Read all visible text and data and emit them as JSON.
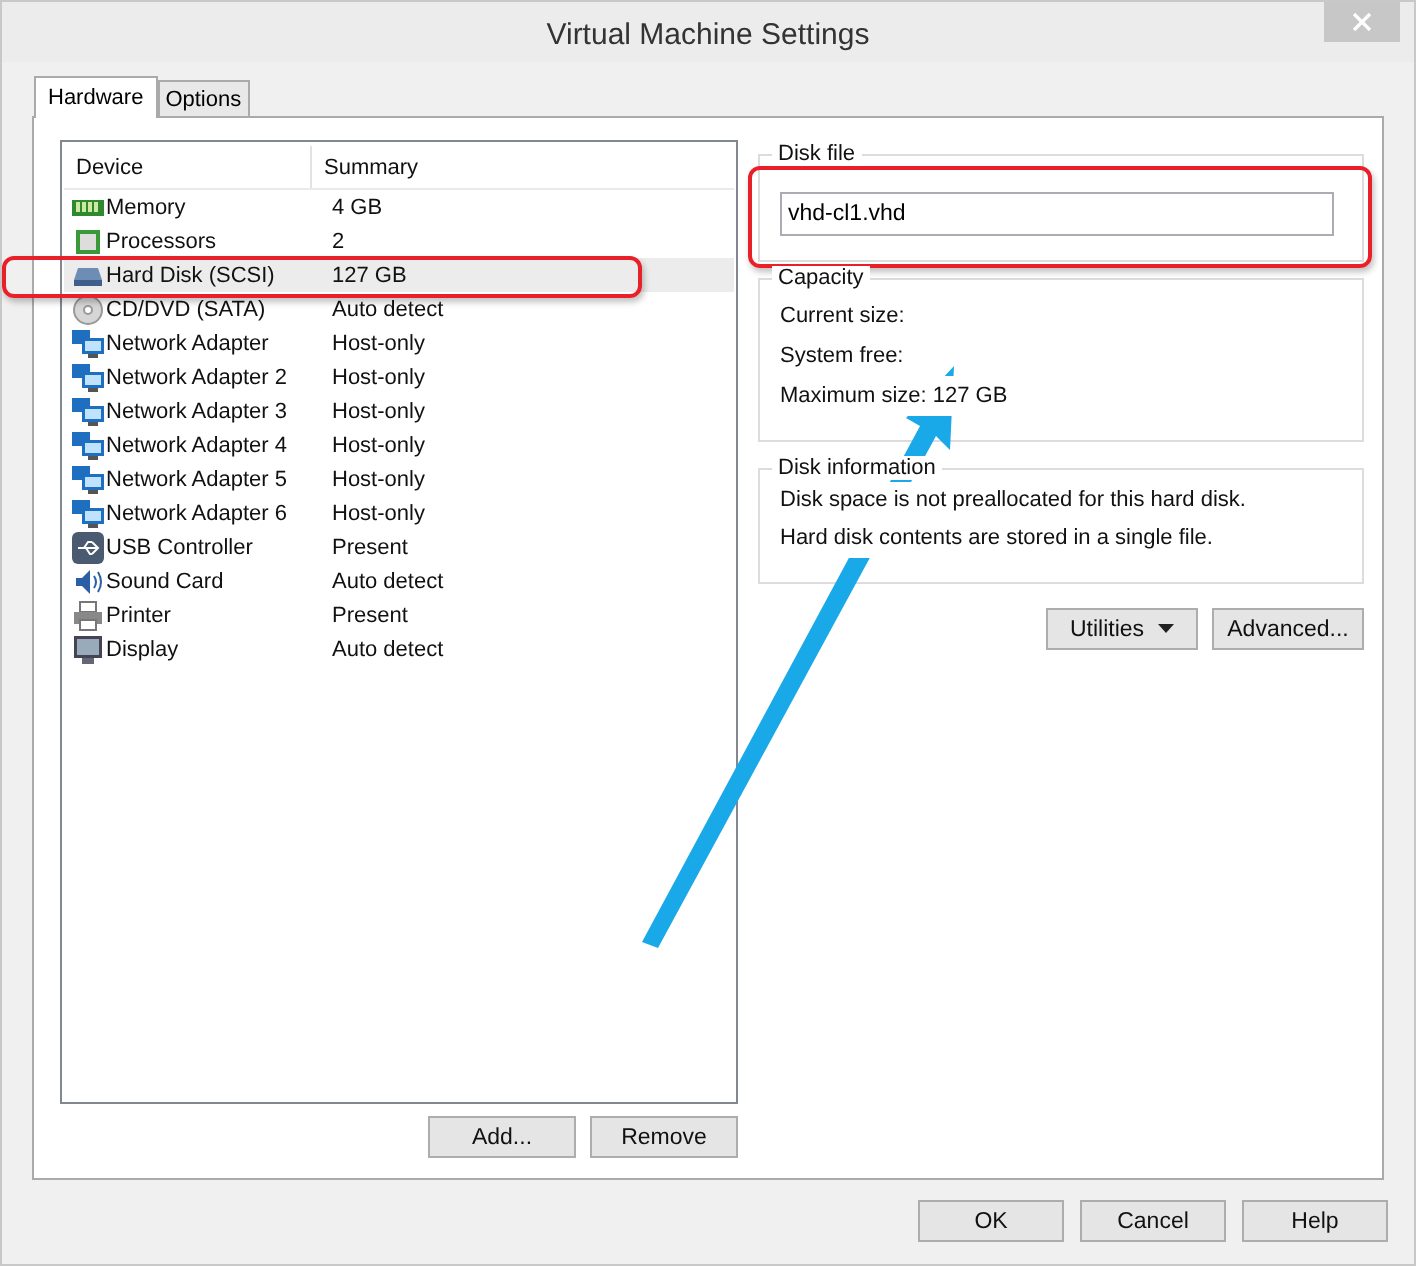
{
  "window": {
    "title": "Virtual Machine Settings"
  },
  "tabs": [
    {
      "label": "Hardware",
      "selected": true
    },
    {
      "label": "Options",
      "selected": false
    }
  ],
  "device_list": {
    "columns": [
      "Device",
      "Summary"
    ],
    "rows": [
      {
        "kind": "memory",
        "device": "Memory",
        "summary": "4 GB",
        "selected": false
      },
      {
        "kind": "processor",
        "device": "Processors",
        "summary": "2",
        "selected": false
      },
      {
        "kind": "disk",
        "device": "Hard Disk (SCSI)",
        "summary": "127 GB",
        "selected": true
      },
      {
        "kind": "cd",
        "device": "CD/DVD (SATA)",
        "summary": "Auto detect",
        "selected": false
      },
      {
        "kind": "network",
        "device": "Network Adapter",
        "summary": "Host-only",
        "selected": false
      },
      {
        "kind": "network",
        "device": "Network Adapter 2",
        "summary": "Host-only",
        "selected": false
      },
      {
        "kind": "network",
        "device": "Network Adapter 3",
        "summary": "Host-only",
        "selected": false
      },
      {
        "kind": "network",
        "device": "Network Adapter 4",
        "summary": "Host-only",
        "selected": false
      },
      {
        "kind": "network",
        "device": "Network Adapter 5",
        "summary": "Host-only",
        "selected": false
      },
      {
        "kind": "network",
        "device": "Network Adapter 6",
        "summary": "Host-only",
        "selected": false
      },
      {
        "kind": "usb",
        "device": "USB Controller",
        "summary": "Present",
        "selected": false
      },
      {
        "kind": "sound",
        "device": "Sound Card",
        "summary": "Auto detect",
        "selected": false
      },
      {
        "kind": "printer",
        "device": "Printer",
        "summary": "Present",
        "selected": false
      },
      {
        "kind": "display",
        "device": "Display",
        "summary": "Auto detect",
        "selected": false
      }
    ]
  },
  "list_buttons": [
    "Add...",
    "Remove"
  ],
  "disk_file": {
    "label": "Disk file",
    "value": "vhd-cl1.vhd"
  },
  "capacity": {
    "label": "Capacity",
    "lines": [
      "Current size:",
      "System free:",
      "Maximum size: 127 GB"
    ]
  },
  "disk_information": {
    "label": "Disk information",
    "lines": [
      "Disk space is not preallocated for this hard disk.",
      "Hard disk contents are stored in a single file."
    ]
  },
  "action_buttons": [
    {
      "label": "Utilities",
      "dropdown": true
    },
    {
      "label": "Advanced...",
      "dropdown": false
    }
  ],
  "dialog_buttons": [
    "OK",
    "Cancel",
    "Help"
  ],
  "annotations": [
    {
      "kind": "box",
      "color": "#e8202a"
    },
    {
      "kind": "box",
      "color": "#e8202a"
    },
    {
      "kind": "arrow",
      "color": "#1aa9e8"
    }
  ]
}
